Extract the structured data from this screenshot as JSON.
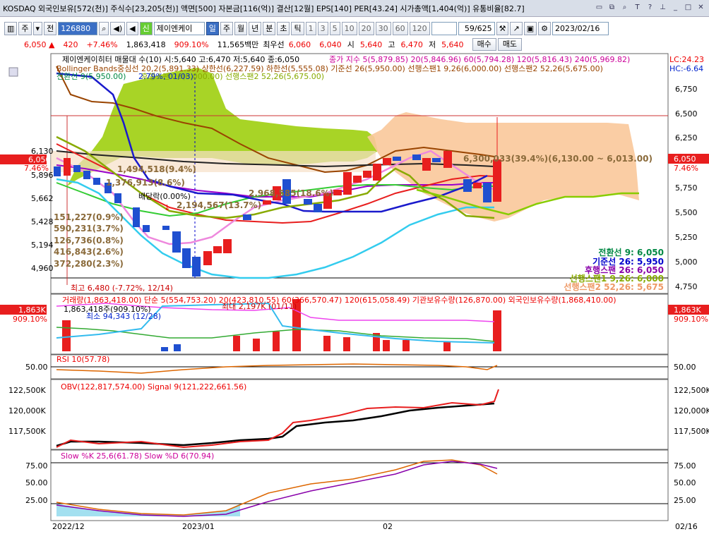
{
  "titlebar": {
    "text": "KOSDAQ 외국인보유[572(천)] 주식수[23,205(천)] 액면[500] 자본금[116(억)] 결산[12월] EPS[140] PER[43.24] 시가총액[1,404(억)] 유통비율[82.7]",
    "icons": [
      "restore-icon",
      "multi-window-icon",
      "search-icon",
      "text-icon",
      "help-icon",
      "pin-icon",
      "minimize-icon",
      "maximize-icon",
      "close-icon"
    ]
  },
  "toolbar": {
    "period_unit": "주",
    "period_sel": "전",
    "code": "126880",
    "stock_name": "제이엔케이",
    "tabs": [
      "일",
      "주",
      "월",
      "년",
      "분",
      "초",
      "틱"
    ],
    "intervals": [
      "1",
      "3",
      "5",
      "10",
      "20",
      "30",
      "60",
      "120"
    ],
    "count": "59/625",
    "date": "2023/02/16"
  },
  "quote": {
    "price": "6,050",
    "change": "420",
    "change_pct": "+7.46%",
    "volume": "1,863,418",
    "vol_ratio": "909.10%",
    "amount": "11,565백만",
    "best_ask_label": "최우선",
    "ask": "6,060",
    "bid": "6,040",
    "open_label": "시",
    "open": "5,640",
    "high_label": "고",
    "high": "6,470",
    "low_label": "저",
    "low": "5,640",
    "buy_label": "매수",
    "sell_label": "매도"
  },
  "main_panel": {
    "header1": "제이엔케이히터 매물대 수(10)  시:5,640 고:6,470 저:5,640 종:6,050",
    "ma_line": "종가 지수 5(5,879.85)  20(5,846.96)  60(5,794.28)  120(5,816.43)  240(5,969.82)",
    "header2": "Bollinger Bands중심선 20,2(5,891.33)  상한선(6,227.59)  하한선(5,555.08)  기준선 26(5,950.00)  선행스팬1 9,26(6,000.00)  선행스팬2 52,26(5,675.00)",
    "header3": "전환선 9(5,950.00)",
    "header4": "후행스팬 26(6,000.00)  선행스팬2 52,26(5,675.00)",
    "right_top": "LC:24.23",
    "right_top2": "HC:-6.64",
    "price_tag": "6,050",
    "pct_tag": "7.46%",
    "y_ticks": [
      "6,750",
      "6,500",
      "6,250",
      "5,750",
      "5,500",
      "5,250",
      "5,000",
      "4,750"
    ],
    "left_ticks": [
      "6,130",
      "5,896",
      "5,662",
      "5,428",
      "5,194",
      "4,960"
    ],
    "volume_profile": [
      "151,227(0.9%)",
      "590,231(3.7%)",
      "126,736(0.8%)",
      "416,843(2.6%)",
      "372,280(2.3%)"
    ],
    "annot": {
      "a1": "1,494,518(9.4%)",
      "a2": "1,376,913(8.6%)",
      "a3": "배당락(0.00%)",
      "a4": "2,194,567(13.7%)",
      "a5": "2,968,585(18.6%)",
      "a6": "6,300,033(39.4%)(6,130.00 ~ 6,013.00)",
      "high_label": "최고 6,480 (-7.72%, 12/14)",
      "low_small": "2.79%, 01/03)"
    },
    "legend": [
      {
        "label": "전환선  9: 6,050",
        "color": "#008844"
      },
      {
        "label": "기준선  26: 5,950",
        "color": "#0000cc"
      },
      {
        "label": "후행스팬  26: 6,050",
        "color": "#8800aa"
      },
      {
        "label": "선행스팬1 9,26: 6,000",
        "color": "#88aa00"
      },
      {
        "label": "선행스팬2 52,26: 5,675",
        "color": "#ee9966"
      }
    ]
  },
  "volume_panel": {
    "header": "거래량(1,863,418.00)  단순 5(554,753.20)  20(423,810.55)  60(366,570.47)  120(615,058.49)  기관보유수량(126,870.00)  외국인보유수량(1,868,410.00)",
    "sub1": "1,863,418주(909.10%)",
    "sub2": "최소 94,343 (12/28)",
    "sub3": "최대 2,197K (01/11)",
    "foreign": "1,863,418주(909.10%)",
    "tag": "1,863K",
    "tag_pct": "909.10%"
  },
  "rsi_panel": {
    "header": "RSI 10(57.78)",
    "tick": "50.00"
  },
  "obv_panel": {
    "header": "OBV(122,817,574.00)  Signal 9(121,222,661.56)",
    "ticks": [
      "122,500K",
      "120,000K",
      "117,500K"
    ]
  },
  "slow_panel": {
    "header": "Slow %K 25,6(61.78)  Slow %D 6(70.94)",
    "ticks": [
      "75.00",
      "50.00",
      "25.00"
    ]
  },
  "xaxis": [
    "2022/12",
    "2023/01",
    "02",
    "02/16"
  ],
  "colors": {
    "up": "#e81e1e",
    "down": "#1f4fd0",
    "cloud_green": "#99cc00",
    "cloud_orange": "#f9c89a"
  }
}
